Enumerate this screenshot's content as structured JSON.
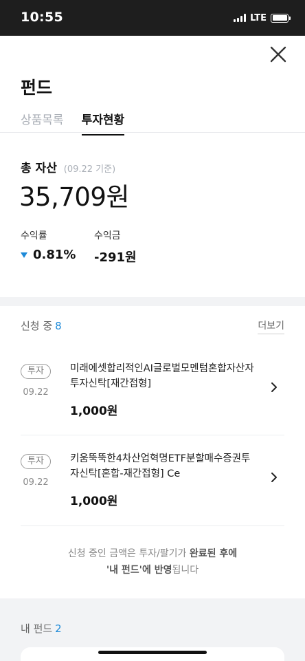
{
  "status_bar": {
    "time": "10:55",
    "network": "LTE",
    "icons": [
      "signal-icon",
      "battery-icon"
    ]
  },
  "header": {
    "title": "펀드",
    "close_icon": "close-icon"
  },
  "tabs": [
    {
      "label": "상품목록",
      "active": false
    },
    {
      "label": "투자현황",
      "active": true
    }
  ],
  "summary": {
    "total_label": "총 자산",
    "date_note": "(09.22 기준)",
    "total_value": "35,709원",
    "return_rate_label": "수익률",
    "return_rate_value": "0.81%",
    "return_rate_direction": "down",
    "profit_label": "수익금",
    "profit_value": "-291원"
  },
  "pending": {
    "label": "신청 중",
    "count": "8",
    "more_label": "더보기",
    "items": [
      {
        "badge": "투자",
        "date": "09.22",
        "name": "미래에셋합리적인AI글로벌모멘텀혼합자산자투자신탁[재간접형]",
        "amount": "1,000원"
      },
      {
        "badge": "투자",
        "date": "09.22",
        "name": "키움뚝뚝한4차산업혁명ETF분할매수증권투자신탁[혼합-재간접형] Ce",
        "amount": "1,000원"
      }
    ],
    "note_parts": [
      "신청 중인 금액은 투자/팔기가 ",
      "완료된 후에",
      "'내 펀드'에 반영",
      "됩니다"
    ]
  },
  "my_funds": {
    "label": "내 펀드",
    "count": "2"
  },
  "colors": {
    "accent": "#1d8ad8",
    "background": "#f2f3f5",
    "status_bar": "#1e1e1e"
  }
}
